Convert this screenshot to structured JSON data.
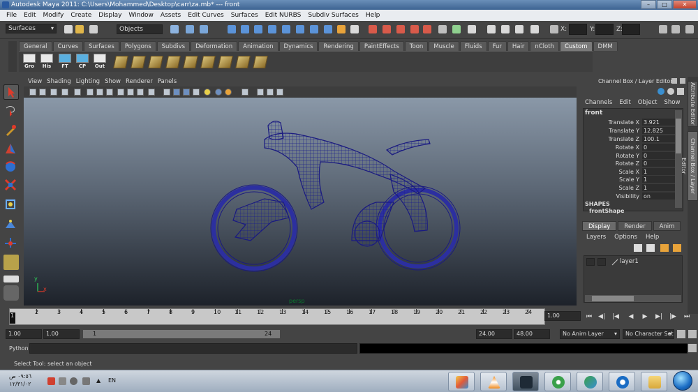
{
  "title_bar": {
    "title": "Autodesk Maya 2011: C:\\Users\\Mohammed\\Desktop\\carr\\za.mb*   ---   front",
    "min": "–",
    "max": "□",
    "close": "✕"
  },
  "menu": [
    "File",
    "Edit",
    "Modify",
    "Create",
    "Display",
    "Window",
    "Assets",
    "Edit Curves",
    "Surfaces",
    "Edit NURBS",
    "Subdiv Surfaces",
    "Help"
  ],
  "status_line": {
    "mode": "Surfaces",
    "objects_field": "Objects",
    "x_label": "X:",
    "y_label": "Y:",
    "z_label": "Z:"
  },
  "shelf_tabs": [
    "General",
    "Curves",
    "Surfaces",
    "Polygons",
    "Subdivs",
    "Deformation",
    "Animation",
    "Dynamics",
    "Rendering",
    "PaintEffects",
    "Toon",
    "Muscle",
    "Fluids",
    "Fur",
    "Hair",
    "nCloth",
    "Custom",
    "DMM"
  ],
  "shelf_active": "Custom",
  "shelf_buttons": [
    "Gro",
    "His",
    "FT",
    "CP",
    "Out"
  ],
  "panel_menu": [
    "View",
    "Shading",
    "Lighting",
    "Show",
    "Renderer",
    "Panels"
  ],
  "viewport": {
    "camera_label": "persp",
    "axis_y": "y",
    "axis_x": "x"
  },
  "channel_box": {
    "title": "Channel Box / Layer Editor",
    "menu": [
      "Channels",
      "Edit",
      "Object",
      "Show"
    ],
    "object_name": "front",
    "attributes": [
      {
        "name": "Translate X",
        "value": "3.921"
      },
      {
        "name": "Translate Y",
        "value": "12.825"
      },
      {
        "name": "Translate Z",
        "value": "100.1"
      },
      {
        "name": "Rotate X",
        "value": "0"
      },
      {
        "name": "Rotate Y",
        "value": "0"
      },
      {
        "name": "Rotate Z",
        "value": "0"
      },
      {
        "name": "Scale X",
        "value": "1"
      },
      {
        "name": "Scale Y",
        "value": "1"
      },
      {
        "name": "Scale Z",
        "value": "1"
      },
      {
        "name": "Visibility",
        "value": "on"
      }
    ],
    "shapes_header": "SHAPES",
    "shape_name": "frontShape"
  },
  "layer_editor": {
    "tabs": [
      "Display",
      "Render",
      "Anim"
    ],
    "active_tab": "Display",
    "menu": [
      "Layers",
      "Options",
      "Help"
    ],
    "layer_name": "layer1"
  },
  "side_tabs": [
    "Attribute Editor",
    "Channel Box / Layer Editor"
  ],
  "time_slider": {
    "tick_labels": [
      "1",
      "2",
      "3",
      "4",
      "5",
      "6",
      "7",
      "8",
      "9",
      "10",
      "11",
      "12",
      "13",
      "14",
      "15",
      "16",
      "17",
      "18",
      "19",
      "20",
      "21",
      "22",
      "23",
      "24"
    ],
    "current_frame": "1",
    "current_field": "1.00"
  },
  "range_slider": {
    "start_time": "1.00",
    "playback_start": "1.00",
    "range_start": "1",
    "range_end": "24",
    "playback_end": "24.00",
    "end_time": "48.00",
    "anim_layer": "No Anim Layer",
    "character_set": "No Character Set"
  },
  "command_line": {
    "label": "Python"
  },
  "help_line": "Select Tool: select an object",
  "taskbar": {
    "time": "٠٩:٥٦ ص",
    "date": "١٢/٣١/٠٢",
    "language": "EN"
  }
}
